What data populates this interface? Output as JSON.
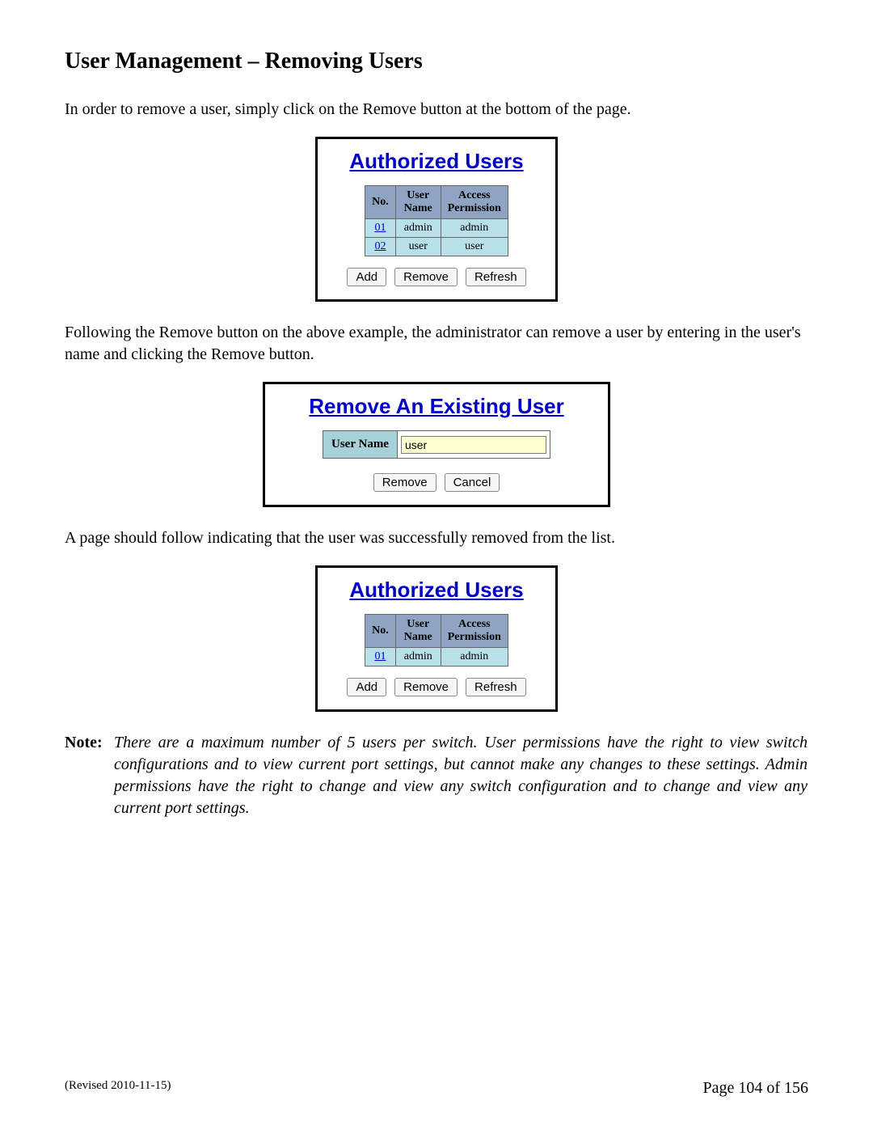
{
  "title": "User Management – Removing Users",
  "para1": "In order to remove a user, simply click on the Remove button at the bottom of the page.",
  "panelA": {
    "title": "Authorized Users",
    "headers": {
      "no": "No.",
      "name": "User\nName",
      "perm": "Access\nPermission"
    },
    "rows": [
      {
        "no": "01",
        "name": "admin",
        "perm": "admin"
      },
      {
        "no": "02",
        "name": "user",
        "perm": "user"
      }
    ],
    "buttons": {
      "add": "Add",
      "remove": "Remove",
      "refresh": "Refresh"
    }
  },
  "para2": "Following the Remove button on the above example, the administrator can remove a user by entering in the user's name and clicking the Remove button.",
  "panelB": {
    "title": "Remove An Existing User",
    "label": "User Name",
    "value": "user",
    "buttons": {
      "remove": "Remove",
      "cancel": "Cancel"
    }
  },
  "para3": "A page should follow indicating that the user was successfully removed from the list.",
  "panelC": {
    "title": "Authorized Users",
    "headers": {
      "no": "No.",
      "name": "User\nName",
      "perm": "Access\nPermission"
    },
    "rows": [
      {
        "no": "01",
        "name": "admin",
        "perm": "admin"
      }
    ],
    "buttons": {
      "add": "Add",
      "remove": "Remove",
      "refresh": "Refresh"
    }
  },
  "note": {
    "label": "Note:",
    "text": "There are a maximum number of 5 users per switch.  User permissions have the right to view switch configurations and to view current port settings, but cannot make any changes to these settings.  Admin permissions have the right to change and view any switch configuration and to change and view any current port settings."
  },
  "footer": {
    "revised": "(Revised 2010-11-15)",
    "page": "Page 104 of 156"
  }
}
